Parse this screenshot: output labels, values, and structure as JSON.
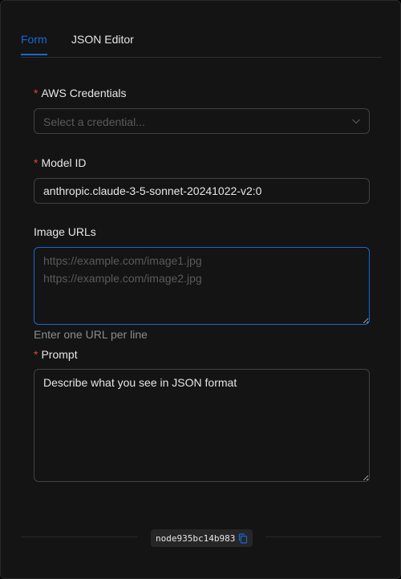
{
  "tabs": [
    {
      "label": "Form",
      "active": true
    },
    {
      "label": "JSON Editor",
      "active": false
    }
  ],
  "fields": {
    "credentials": {
      "label": "AWS Credentials",
      "required_mark": "*",
      "placeholder": "Select a credential..."
    },
    "model_id": {
      "label": "Model ID",
      "required_mark": "*",
      "value": "anthropic.claude-3-5-sonnet-20241022-v2:0"
    },
    "image_urls": {
      "label": "Image URLs",
      "placeholder": "https://example.com/image1.jpg\nhttps://example.com/image2.jpg",
      "help": "Enter one URL per line"
    },
    "prompt": {
      "label": "Prompt",
      "required_mark": "*",
      "value": "Describe what you see in JSON format"
    }
  },
  "footer": {
    "node_id": "node935bc14b983",
    "copy_icon": "copy-icon"
  },
  "colors": {
    "accent": "#1668dc",
    "required": "#dc4446",
    "background": "#141414",
    "border": "#424242"
  }
}
